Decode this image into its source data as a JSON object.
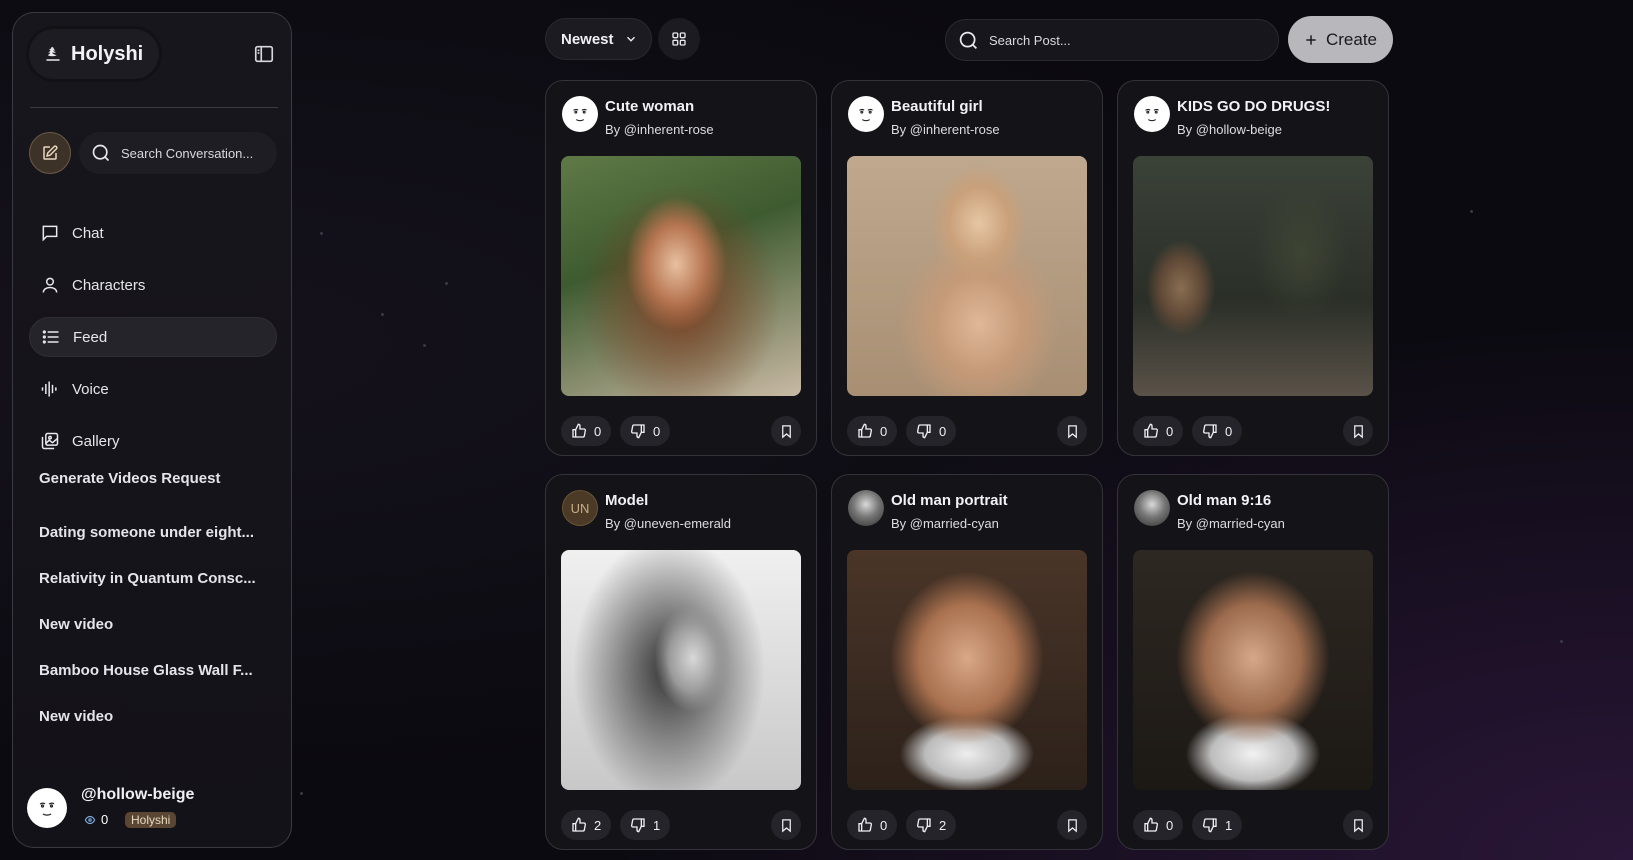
{
  "app": {
    "name": "Holyshi"
  },
  "sidebar": {
    "search_placeholder": "Search Conversation...",
    "nav": [
      {
        "label": "Chat",
        "icon": "chat-icon"
      },
      {
        "label": "Characters",
        "icon": "user-icon"
      },
      {
        "label": "Feed",
        "icon": "list-icon",
        "active": true
      },
      {
        "label": "Voice",
        "icon": "waveform-icon"
      },
      {
        "label": "Gallery",
        "icon": "gallery-icon"
      }
    ],
    "conversations": [
      "Generate Videos Request",
      "Dating someone under eight...",
      "Relativity in Quantum Consc...",
      "New video",
      "Bamboo House Glass Wall F...",
      "New video"
    ],
    "user": {
      "handle": "@hollow-beige",
      "credits": "0",
      "plan": "Holyshi"
    }
  },
  "toolbar": {
    "sort_label": "Newest",
    "search_placeholder": "Search Post...",
    "create_label": "Create"
  },
  "posts": [
    {
      "title": "Cute woman",
      "author": "By @inherent-rose",
      "likes": "0",
      "dislikes": "0",
      "avatar": "face-sketch"
    },
    {
      "title": "Beautiful girl",
      "author": "By @inherent-rose",
      "likes": "0",
      "dislikes": "0",
      "avatar": "face-sketch"
    },
    {
      "title": "KIDS GO DO DRUGS!",
      "author": "By @hollow-beige",
      "likes": "0",
      "dislikes": "0",
      "avatar": "face-sketch"
    },
    {
      "title": "Model",
      "author": "By @uneven-emerald",
      "likes": "2",
      "dislikes": "1",
      "avatar": "initials",
      "initials": "UN"
    },
    {
      "title": "Old man portrait",
      "author": "By @married-cyan",
      "likes": "0",
      "dislikes": "2",
      "avatar": "photo"
    },
    {
      "title": "Old man 9:16",
      "author": "By @married-cyan",
      "likes": "0",
      "dislikes": "1",
      "avatar": "photo"
    }
  ]
}
